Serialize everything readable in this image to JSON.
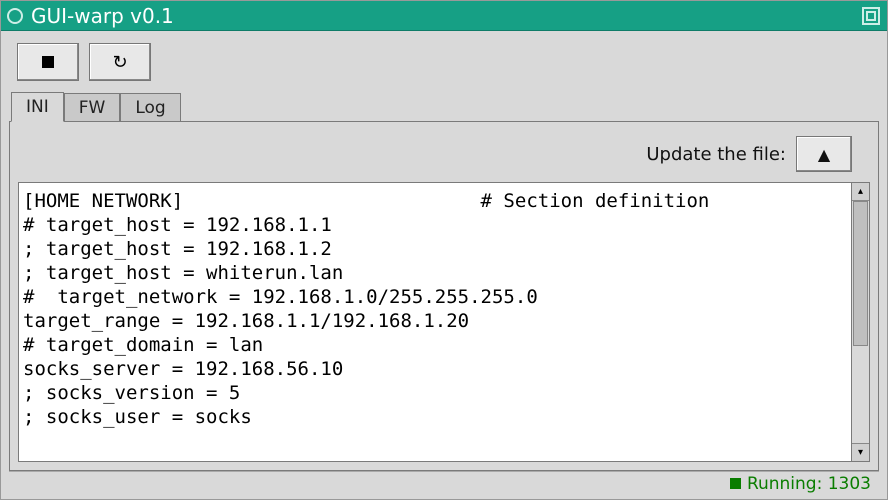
{
  "window": {
    "title": "GUI-warp v0.1"
  },
  "toolbar": {
    "stop_tooltip": "Stop",
    "reload_tooltip": "Reload"
  },
  "tabs": [
    {
      "id": "ini",
      "label": "INI",
      "active": true
    },
    {
      "id": "fw",
      "label": "FW",
      "active": false
    },
    {
      "id": "log",
      "label": "Log",
      "active": false
    }
  ],
  "ini_tab": {
    "update_label": "Update the file:",
    "upload_icon": "▲",
    "content": "[HOME NETWORK]                          # Section definition\n# target_host = 192.168.1.1\n; target_host = 192.168.1.2\n; target_host = whiterun.lan\n#  target_network = 192.168.1.0/255.255.255.0\ntarget_range = 192.168.1.1/192.168.1.20\n# target_domain = lan\nsocks_server = 192.168.56.10\n; socks_version = 5\n; socks_user = socks"
  },
  "status": {
    "text": "Running: 1303",
    "color": "#0a7d00"
  },
  "icons": {
    "reload": "↻"
  }
}
